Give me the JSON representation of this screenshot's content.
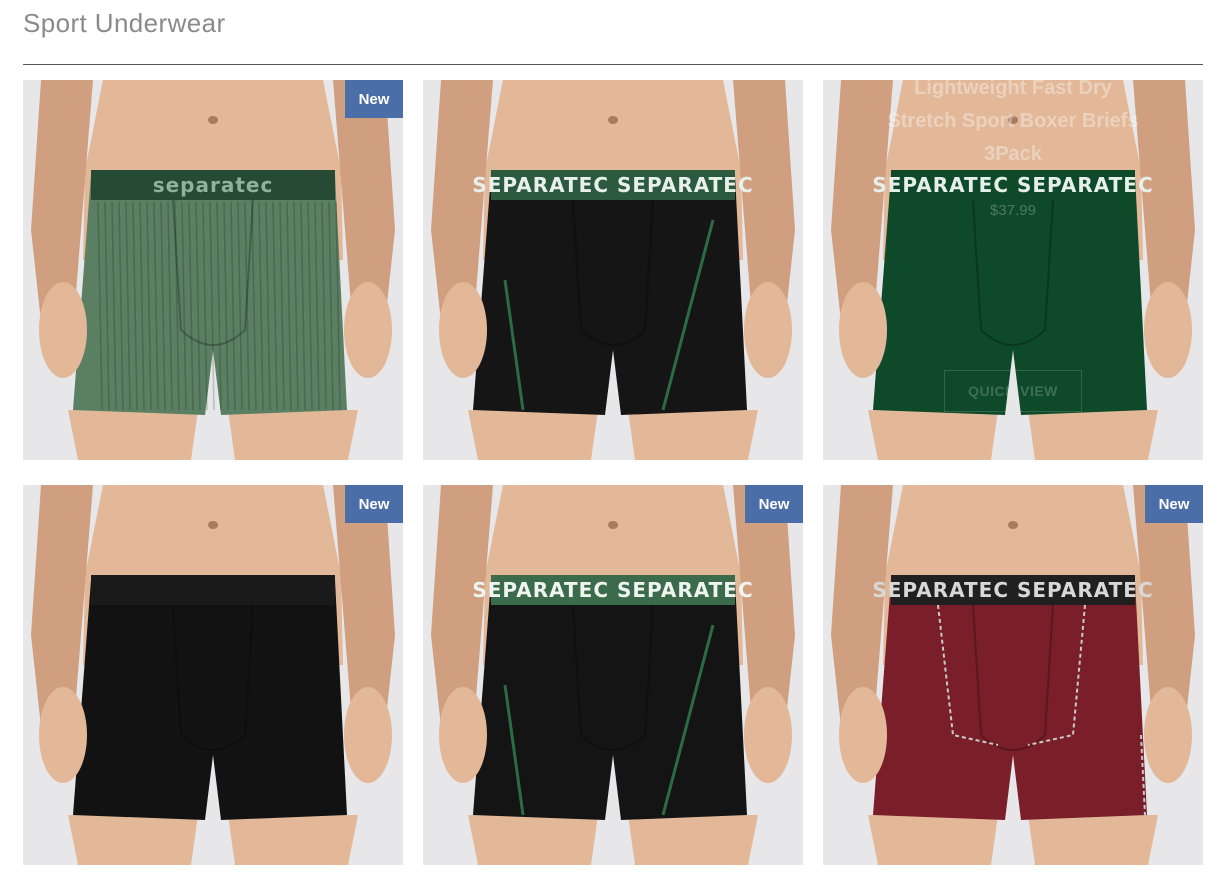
{
  "page": {
    "title": "Sport Underwear"
  },
  "colors": {
    "badge": "#4b6ea8",
    "bg": "#e7e7e9"
  },
  "products": [
    {
      "badge": "New",
      "brand_text": "separatec",
      "color": "#5b7f62",
      "band": "#274a34",
      "band_text_color": "#8fb29a",
      "style": "ribbed",
      "hover": false
    },
    {
      "badge": "",
      "brand_text": "SEPARATEC SEPARATEC",
      "color": "#151515",
      "band": "#2c5a3f",
      "band_text_color": "#e8f0ea",
      "style": "trunk-piping",
      "hover": false
    },
    {
      "badge": "",
      "brand_text": "SEPARATEC SEPARATEC",
      "color": "#0e4a2a",
      "band": "#0e4a2a",
      "band_text_color": "#e6efe9",
      "style": "plain",
      "hover": true,
      "quick_name": "Lightweight Fast Dry Stretch Sport Boxer Briefs 3Pack",
      "quick_price": "$37.99",
      "quick_view": "QUICK VIEW"
    },
    {
      "badge": "New",
      "brand_text": "",
      "color": "#121212",
      "band": "#1a1a1a",
      "band_text_color": "#333333",
      "style": "plain",
      "hover": false
    },
    {
      "badge": "New",
      "brand_text": "SEPARATEC SEPARATEC",
      "color": "#141414",
      "band": "#3c6b4c",
      "band_text_color": "#eef4ef",
      "style": "piping",
      "hover": false
    },
    {
      "badge": "New",
      "brand_text": "SEPARATEC SEPARATEC",
      "color": "#7a1f2a",
      "band": "#202020",
      "band_text_color": "#d8d8d8",
      "style": "maroon-piping",
      "hover": false
    }
  ]
}
